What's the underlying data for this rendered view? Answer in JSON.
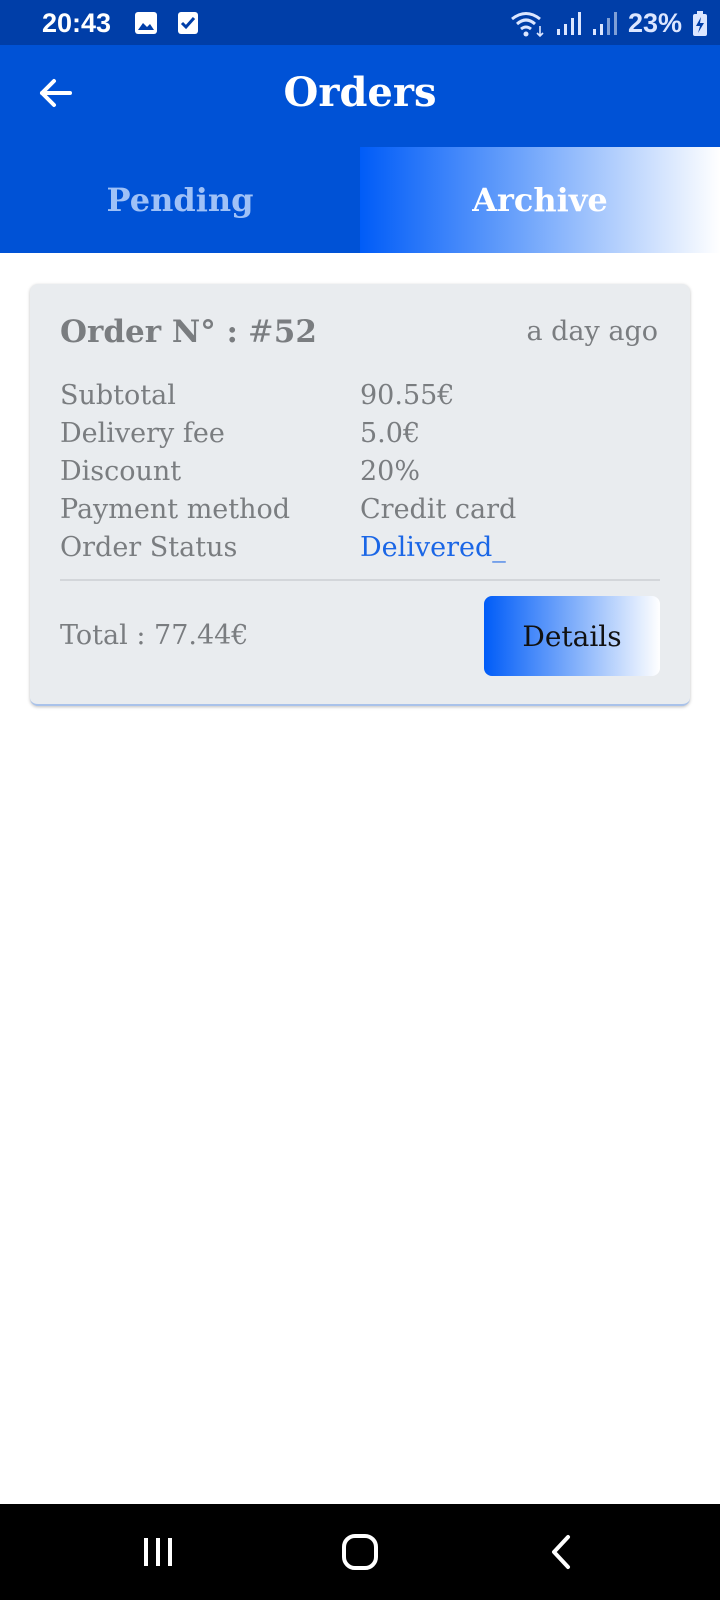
{
  "status_bar": {
    "time": "20:43",
    "battery": "23%",
    "icons": [
      "image-icon",
      "checkbox-notification-icon",
      "wifi-icon",
      "signal-icon",
      "signal-icon-2",
      "battery-charging-icon"
    ]
  },
  "app_bar": {
    "title": "Orders",
    "back_icon": "arrow-left-icon"
  },
  "tabs": [
    {
      "label": "Pending",
      "selected": false
    },
    {
      "label": "Archive",
      "selected": true
    }
  ],
  "order": {
    "label": "Order N° :",
    "hash": "#",
    "number": "52",
    "time_ago": "a day ago",
    "details": [
      {
        "label": "Subtotal",
        "value": "90.55€"
      },
      {
        "label": "Delivery fee",
        "value": "5.0€"
      },
      {
        "label": "Discount",
        "value": "20%"
      },
      {
        "label": "Payment method",
        "value": "Credit card"
      },
      {
        "label": "Order Status",
        "value": "Delivered_"
      }
    ],
    "total": "Total : 77.44€",
    "details_button": "Details"
  },
  "colors": {
    "status_bar": "#003ea8",
    "app_bar": "#0052d6",
    "accent": "#005cf8",
    "delivered": "#1a66e6",
    "card": "#e9ecef"
  },
  "nav_bar": {
    "icons": [
      "recents-icon",
      "home-icon",
      "back-chevron-icon"
    ]
  }
}
